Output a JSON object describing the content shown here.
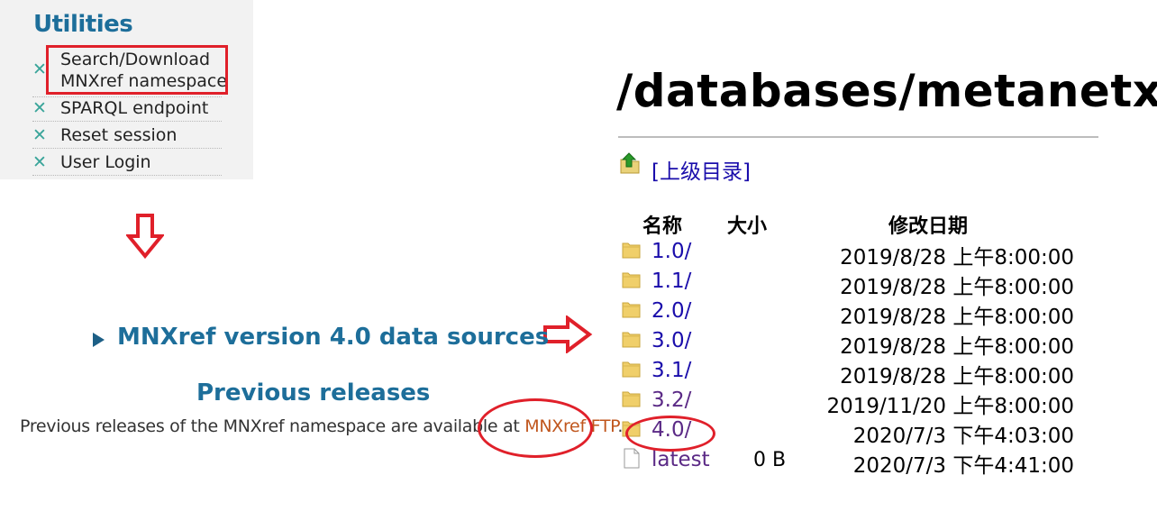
{
  "utilities": {
    "title": "Utilities",
    "items": [
      {
        "label_line1": "Search/Download",
        "label_line2": "MNXref namespace"
      },
      {
        "label": "SPARQL endpoint"
      },
      {
        "label": "Reset session"
      },
      {
        "label": "User Login"
      }
    ]
  },
  "main": {
    "sources_link": "MNXref version 4.0 data sources",
    "previous_heading": "Previous releases",
    "previous_text": "Previous releases of the MNXref namespace are available at ",
    "previous_link": "MNXref FTP",
    "previous_suffix": "."
  },
  "listing": {
    "title": "/databases/metanetx/",
    "parent_link": "[上级目录]",
    "headers": {
      "name": "名称",
      "size": "大小",
      "modified": "修改日期"
    },
    "rows": [
      {
        "name": "1.0/",
        "size": "",
        "date": "2019/8/28 上午8:00:00",
        "type": "folder"
      },
      {
        "name": "1.1/",
        "size": "",
        "date": "2019/8/28 上午8:00:00",
        "type": "folder"
      },
      {
        "name": "2.0/",
        "size": "",
        "date": "2019/8/28 上午8:00:00",
        "type": "folder"
      },
      {
        "name": "3.0/",
        "size": "",
        "date": "2019/8/28 上午8:00:00",
        "type": "folder"
      },
      {
        "name": "3.1/",
        "size": "",
        "date": "2019/8/28 上午8:00:00",
        "type": "folder"
      },
      {
        "name": "3.2/",
        "size": "",
        "date": "2019/11/20 上午8:00:00",
        "type": "folder"
      },
      {
        "name": "4.0/",
        "size": "",
        "date": "2020/7/3 下午4:03:00",
        "type": "folder"
      },
      {
        "name": "latest",
        "size": "0 B",
        "date": "2020/7/3 下午4:41:00",
        "type": "file"
      }
    ]
  },
  "colors": {
    "heading_blue": "#1d6e9a",
    "link_blue": "#1a0dab",
    "link_visited": "#5b2a86",
    "ftp_link": "#c0561d",
    "annotation_red": "#e0202a"
  },
  "icons": {
    "util_bullet": "close-x-icon",
    "parent": "folder-up-icon",
    "folder": "folder-icon",
    "file": "file-icon"
  }
}
